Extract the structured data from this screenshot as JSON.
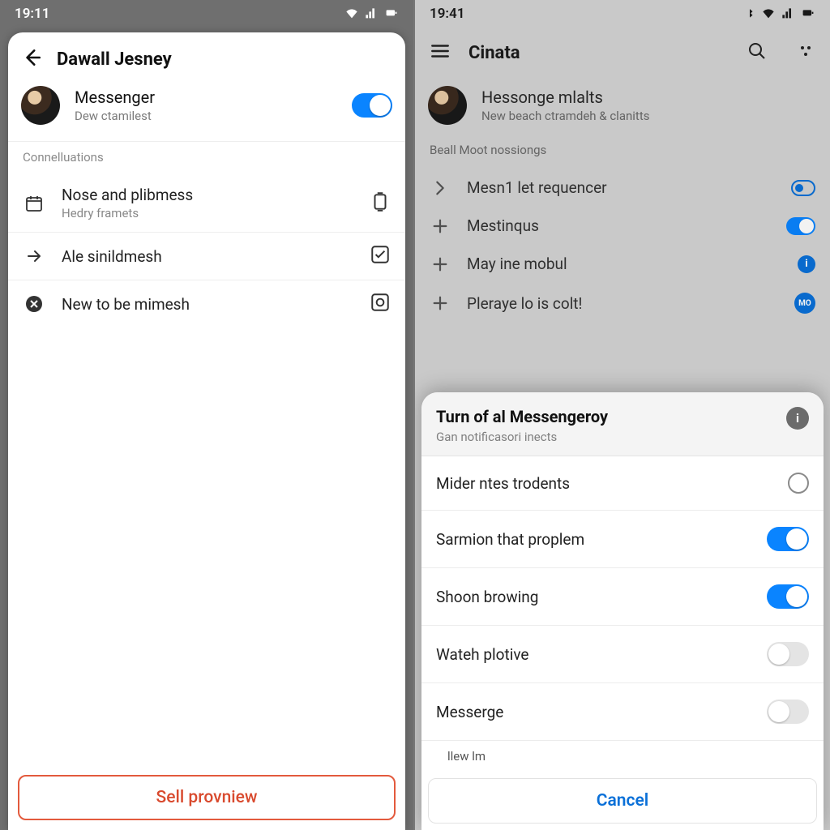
{
  "left": {
    "status_time": "19:11",
    "header_title": "Dawall Jesney",
    "profile": {
      "name": "Messenger",
      "sub": "Dew ctamilest",
      "toggle_on": true
    },
    "section_label": "Connelluations",
    "rows": [
      {
        "title": "Nose and plibmess",
        "sub": "Hedry framets"
      },
      {
        "title": "Ale sinildmesh"
      },
      {
        "title": "New to be mimesh"
      }
    ],
    "footer_button": "Sell provniew"
  },
  "right": {
    "status_time": "19:41",
    "header_title": "Cinata",
    "profile": {
      "name": "Hessonge mlalts",
      "sub": "New beach ctramdeh & clanitts"
    },
    "section_label": "Beall Moot nossiongs",
    "rows": [
      {
        "label": "Mesn1 let requencer"
      },
      {
        "label": "Mestinqus"
      },
      {
        "label": "May ine mobul"
      },
      {
        "label": "Pleraye lo is colt!"
      }
    ],
    "row4_badge": "MO",
    "sheet": {
      "title": "Turn of al Messengeroy",
      "sub": "Gan notificasori inects",
      "info_glyph": "i",
      "options": [
        {
          "label": "Mider ntes trodents",
          "kind": "radio",
          "on": false
        },
        {
          "label": "Sarmion that proplem",
          "kind": "toggle",
          "on": true
        },
        {
          "label": "Shoon browing",
          "kind": "toggle",
          "on": true
        },
        {
          "label": "Wateh plotive",
          "kind": "toggle",
          "on": false
        },
        {
          "label": "Messerge",
          "kind": "toggle",
          "on": false
        }
      ],
      "extra": "llew lm",
      "cancel": "Cancel"
    }
  }
}
